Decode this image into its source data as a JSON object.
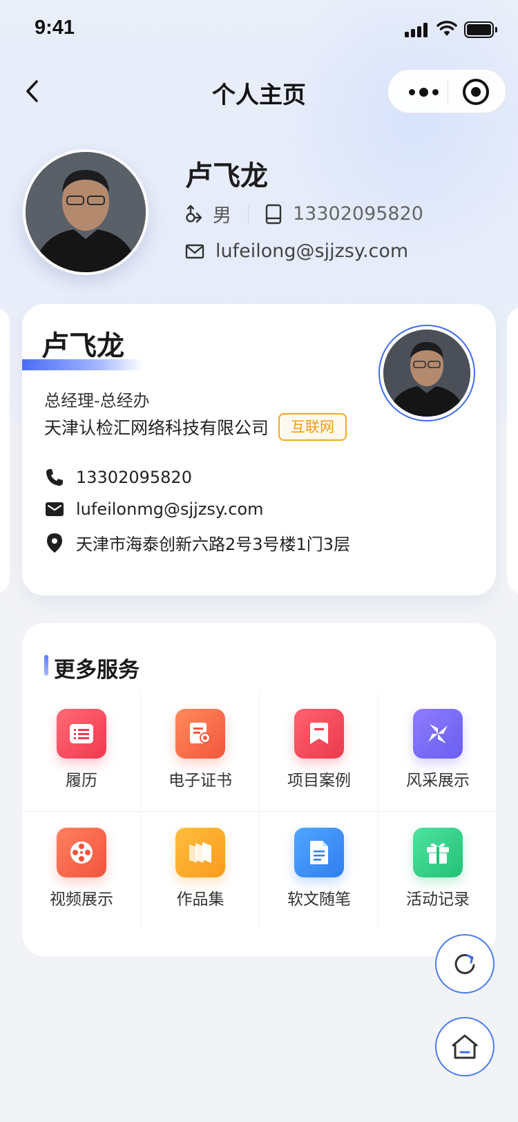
{
  "status_bar": {
    "time": "9:41"
  },
  "nav": {
    "title": "个人主页"
  },
  "profile": {
    "name": "卢飞龙",
    "gender": "男",
    "phone": "13302095820",
    "email": "lufeilong@sjjzsy.com"
  },
  "card": {
    "name": "卢飞龙",
    "title": "总经理-总经办",
    "company": "天津认检汇网络科技有限公司",
    "industry_tag": "互联网",
    "phone": "13302095820",
    "email": "lufeilonmg@sjjzsy.com",
    "address": "天津市海泰创新六路2号3号楼1门3层"
  },
  "services": {
    "title": "更多服务",
    "items": [
      {
        "label": "履历",
        "icon": "resume-icon",
        "color": "#f9475f"
      },
      {
        "label": "电子证书",
        "icon": "certificate-icon",
        "color": "#f7664a"
      },
      {
        "label": "项目案例",
        "icon": "project-case-icon",
        "color": "#f5505f"
      },
      {
        "label": "风采展示",
        "icon": "pinwheel-icon",
        "color": "#7a6cf6"
      },
      {
        "label": "视频展示",
        "icon": "film-reel-icon",
        "color": "#f7664a"
      },
      {
        "label": "作品集",
        "icon": "portfolio-icon",
        "color": "#fba12a"
      },
      {
        "label": "软文随笔",
        "icon": "article-icon",
        "color": "#3d8ff5"
      },
      {
        "label": "活动记录",
        "icon": "gift-icon",
        "color": "#2fcf86"
      }
    ]
  }
}
